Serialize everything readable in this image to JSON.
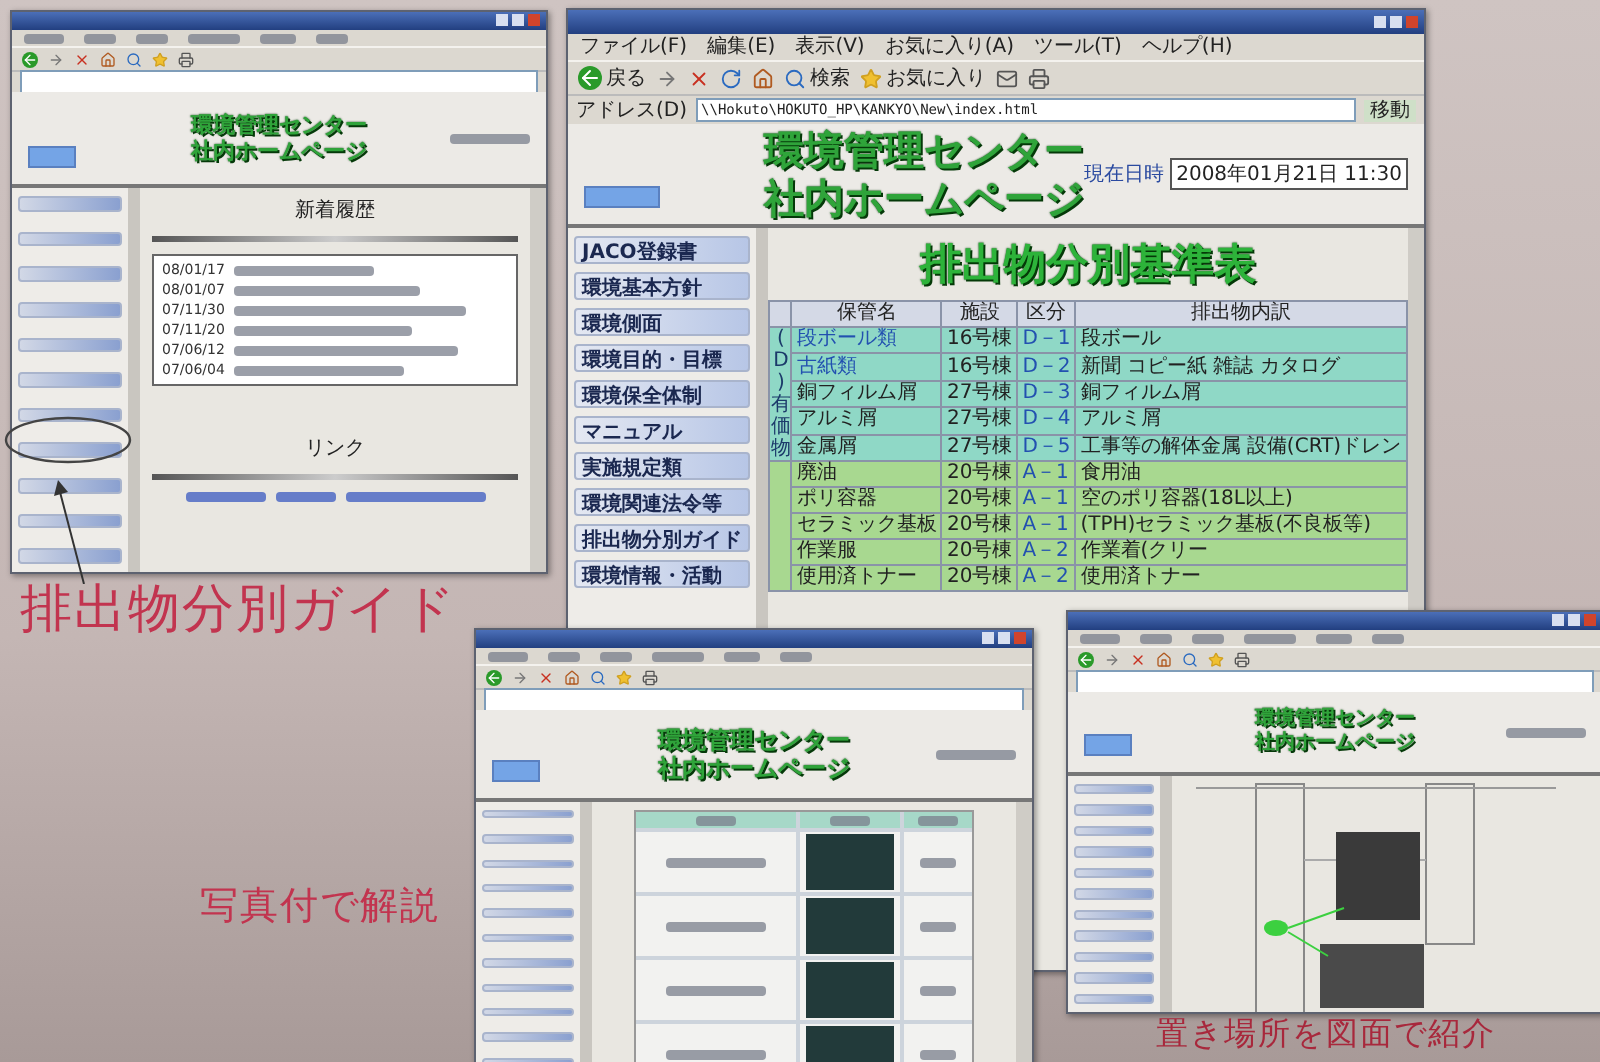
{
  "captions": [
    "排出物分別ガイド",
    "写真付で解説",
    "置き場所を図面で紹介"
  ],
  "main_window": {
    "menu": [
      "ファイル(F)",
      "編集(E)",
      "表示(V)",
      "お気に入り(A)",
      "ツール(T)",
      "ヘルプ(H)"
    ],
    "toolbar": [
      "戻る",
      "検索",
      "お気に入り"
    ],
    "address_label": "アドレス(D)",
    "url": "\\\\Hokuto\\HOKUTO_HP\\KANKYO\\New\\index.html",
    "go": "移動",
    "site_title": [
      "環境管理センター",
      "社内ホームページ"
    ],
    "date_label": "現在日時",
    "date": "2008年01月21日 11:30",
    "nav": [
      "JACO登録書",
      "環境基本方針",
      "環境側面",
      "環境目的・目標",
      "環境保全体制",
      "マニュアル",
      "実施規定類",
      "環境関連法令等",
      "排出物分別ガイド",
      "環境情報・活動"
    ],
    "heading": "排出物分別基準表",
    "table": {
      "columns": [
        "保管名",
        "施設",
        "区分",
        "排出物内訳"
      ],
      "groups": [
        {
          "label": "(D)有価物",
          "color": "#8fd8c6",
          "rows": [
            {
              "name": "段ボール類",
              "facility": "16号棟",
              "code": "D－1",
              "detail": "段ボール"
            },
            {
              "name": "古紙類",
              "facility": "16号棟",
              "code": "D－2",
              "detail": "新聞 コピー紙 雑誌 カタログ"
            },
            {
              "name": "銅フィルム屑",
              "facility": "27号棟",
              "code": "D－3",
              "detail": "銅フィルム屑"
            },
            {
              "name": "アルミ屑",
              "facility": "27号棟",
              "code": "D－4",
              "detail": "アルミ屑"
            },
            {
              "name": "金属屑",
              "facility": "27号棟",
              "code": "D－5",
              "detail": "工事等の解体金属 設備(CRT)ドレン"
            }
          ]
        },
        {
          "color": "#a8d890",
          "rows": [
            {
              "name": "廃油",
              "facility": "20号棟",
              "code": "A－1",
              "detail": "食用油"
            },
            {
              "name": "ポリ容器",
              "facility": "20号棟",
              "code": "A－1",
              "detail": "空のポリ容器(18L以上)"
            },
            {
              "name": "セラミック基板",
              "facility": "20号棟",
              "code": "A－1",
              "detail": "(TPH)セラミック基板(不良板等)"
            },
            {
              "name": "作業服",
              "facility": "20号棟",
              "code": "A－2",
              "detail": "作業着(クリー"
            },
            {
              "name": "使用済トナー",
              "facility": "20号棟",
              "code": "A－2",
              "detail": "使用済トナー"
            }
          ]
        }
      ]
    }
  },
  "guide_window": {
    "site_title": [
      "環境管理センター",
      "社内ホームページ"
    ],
    "news_heading": "新着履歴",
    "news_dates": [
      "08/01/17",
      "08/01/07",
      "07/11/30",
      "07/11/20",
      "07/06/12",
      "07/06/04"
    ],
    "links_heading": "リンク"
  },
  "photo_window": {
    "site_title": [
      "環境管理センター",
      "社内ホームページ"
    ]
  },
  "map_window": {
    "site_title": [
      "環境管理センター",
      "社内ホームページ"
    ]
  }
}
